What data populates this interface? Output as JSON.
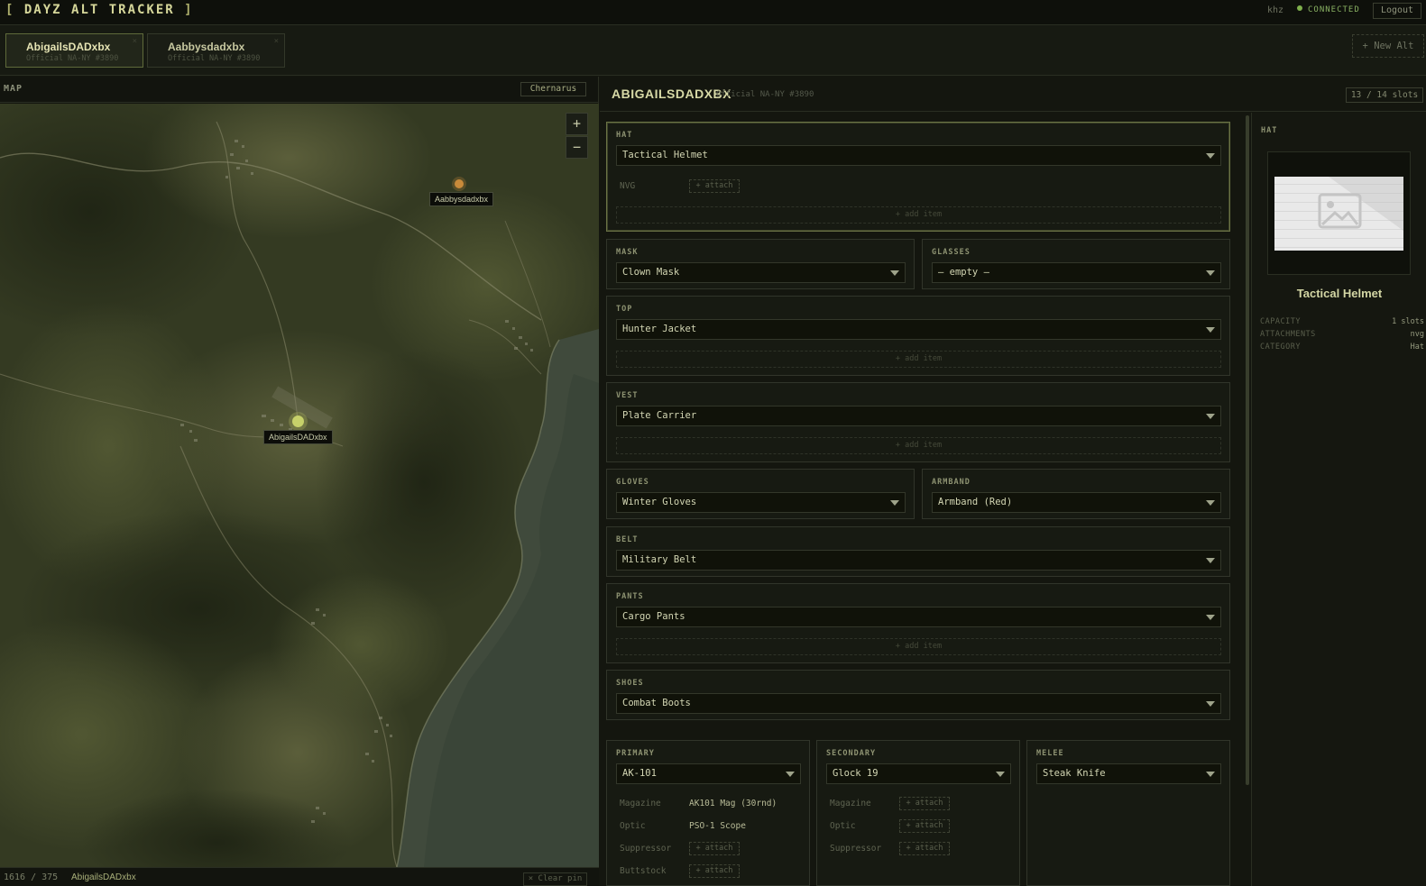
{
  "app": {
    "title_open": "[",
    "title": "DAYZ ALT TRACKER",
    "title_close": "]",
    "user": "khz",
    "status": "CONNECTED",
    "logout_label": "Logout",
    "colors": {
      "accent": "#d6d79a",
      "status": "#7fb04c",
      "pin_self": "#c7d16a",
      "pin_other": "#c98a3a"
    }
  },
  "tabs": [
    {
      "name": "AbigailsDADxbx",
      "server": "Official NA-NY #3890",
      "close": "×",
      "active": true
    },
    {
      "name": "Aabbysdadxbx",
      "server": "Official NA-NY #3890",
      "close": "×",
      "active": false
    }
  ],
  "new_alt_label": "+ New Alt",
  "map": {
    "label": "MAP",
    "selected_map": "Chernarus",
    "zoom_in": "+",
    "zoom_out": "−",
    "pins": [
      {
        "label": "Aabbysdadxbx"
      },
      {
        "label": "AbigailsDADxbx"
      }
    ],
    "coords": "1616 / 375",
    "footer_alt": "AbigailsDADxbx",
    "clear_pin_label": "× Clear pin"
  },
  "loadout": {
    "name": "ABIGAILSDADXBX",
    "server": "Official NA-NY #3890",
    "slots_badge": "13 / 14 slots",
    "add_item_label": "+ add item",
    "attach_label": "+ attach",
    "hat": {
      "title": "HAT",
      "value": "Tactical Helmet",
      "attachments": [
        {
          "label": "NVG"
        }
      ]
    },
    "mask": {
      "title": "MASK",
      "value": "Clown Mask"
    },
    "glasses": {
      "title": "GLASSES",
      "value": "— empty —"
    },
    "top": {
      "title": "TOP",
      "value": "Hunter Jacket"
    },
    "vest": {
      "title": "VEST",
      "value": "Plate Carrier"
    },
    "gloves": {
      "title": "GLOVES",
      "value": "Winter Gloves"
    },
    "armband": {
      "title": "ARMBAND",
      "value": "Armband (Red)"
    },
    "belt": {
      "title": "BELT",
      "value": "Military Belt"
    },
    "pants": {
      "title": "PANTS",
      "value": "Cargo Pants"
    },
    "shoes": {
      "title": "SHOES",
      "value": "Combat Boots"
    },
    "primary": {
      "title": "PRIMARY",
      "value": "AK-101",
      "attachments": [
        {
          "label": "Magazine",
          "value": "AK101 Mag (30rnd)"
        },
        {
          "label": "Optic",
          "value": "PSO-1 Scope"
        },
        {
          "label": "Suppressor"
        },
        {
          "label": "Buttstock"
        }
      ]
    },
    "secondary": {
      "title": "SECONDARY",
      "value": "Glock 19",
      "attachments": [
        {
          "label": "Magazine"
        },
        {
          "label": "Optic"
        },
        {
          "label": "Suppressor"
        }
      ]
    },
    "melee": {
      "title": "MELEE",
      "value": "Steak Knife"
    }
  },
  "detail": {
    "slot": "HAT",
    "item_name": "Tactical Helmet",
    "rows": [
      {
        "key": "CAPACITY",
        "value": "1 slots"
      },
      {
        "key": "ATTACHMENTS",
        "value": "nvg"
      },
      {
        "key": "CATEGORY",
        "value": "Hat"
      }
    ]
  }
}
